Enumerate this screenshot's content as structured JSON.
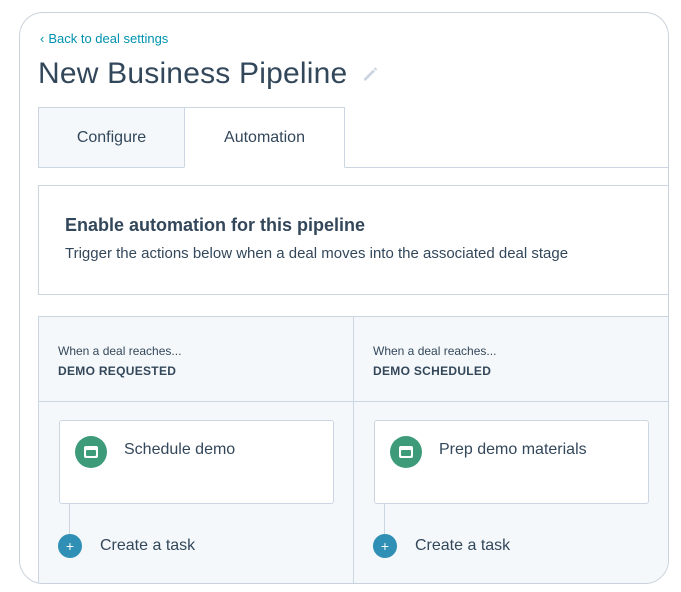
{
  "header": {
    "back_link": "Back to deal settings",
    "title": "New Business Pipeline"
  },
  "tabs": [
    {
      "label": "Configure",
      "active": false
    },
    {
      "label": "Automation",
      "active": true
    }
  ],
  "automation_card": {
    "title": "Enable automation for this pipeline",
    "description": "Trigger the actions below when a deal moves into the associated deal stage"
  },
  "stages": [
    {
      "when_label": "When a deal reaches...",
      "stage_name": "DEMO REQUESTED",
      "task": {
        "label": "Schedule demo",
        "icon": "calendar-icon"
      },
      "create_label": "Create a task"
    },
    {
      "when_label": "When a deal reaches...",
      "stage_name": "DEMO SCHEDULED",
      "task": {
        "label": "Prep demo materials",
        "icon": "calendar-icon"
      },
      "create_label": "Create a task"
    }
  ],
  "colors": {
    "link": "#0091ae",
    "task_icon": "#3d9b7a",
    "add_button": "#2f8fb5",
    "text": "#33475b",
    "border": "#cbd6e2"
  }
}
